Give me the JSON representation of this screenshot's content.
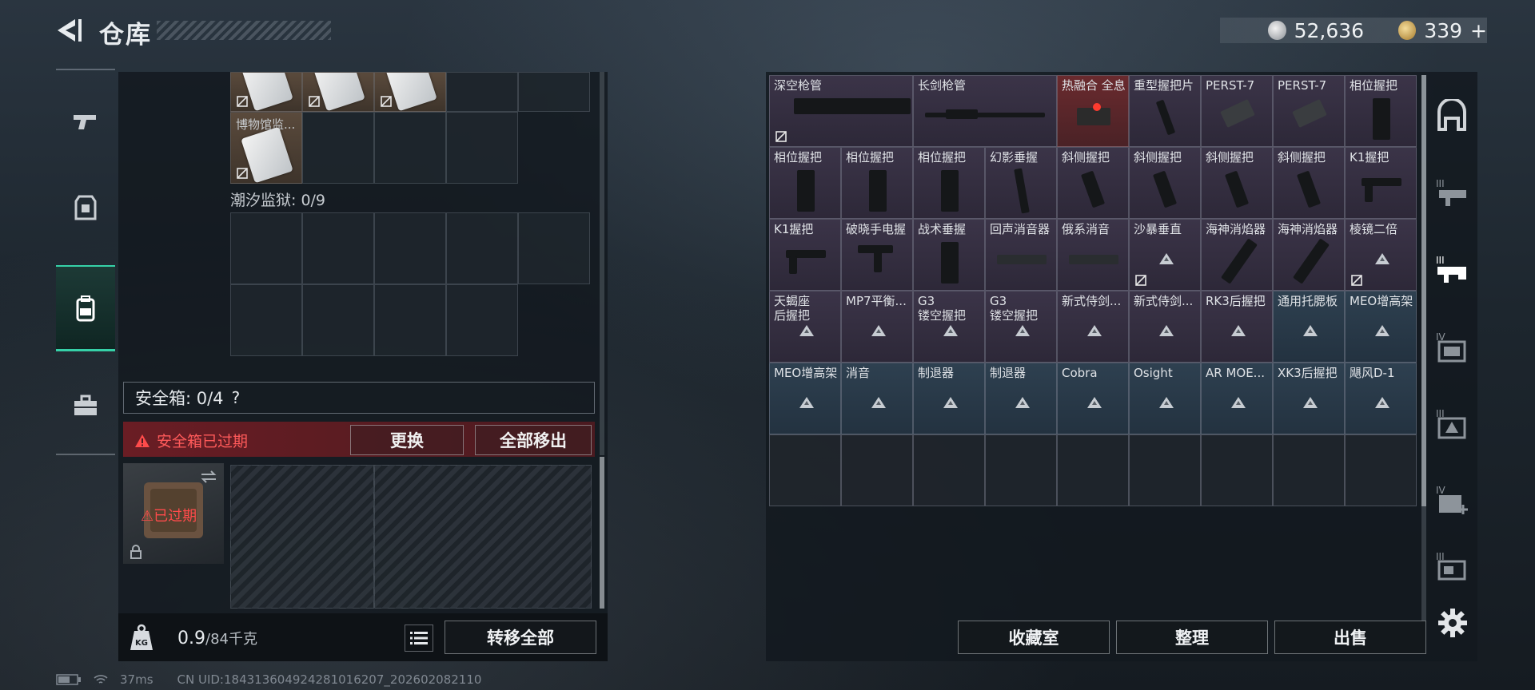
{
  "header": {
    "title": "仓库",
    "silver_amount": "52,636",
    "gold_amount": "339",
    "plus_label": "+"
  },
  "left_tabs": [
    {
      "name": "tab-weapons",
      "icon": "pistol-icon"
    },
    {
      "name": "tab-armor",
      "icon": "armor-icon"
    },
    {
      "name": "tab-backpack",
      "icon": "backpack-icon",
      "active": true
    },
    {
      "name": "tab-toolbox",
      "icon": "toolbox-icon"
    }
  ],
  "container_top": {
    "item_label": "博物馆监...",
    "section_title": "潮汐监狱: 0/9"
  },
  "safe": {
    "title": "安全箱: 0/4",
    "help": "?",
    "warning": "安全箱已过期",
    "replace_label": "更换",
    "remove_all_label": "全部移出",
    "expired_label": "已过期"
  },
  "footer": {
    "weight_value": "0.9",
    "weight_total": "/84千克",
    "transfer_all_label": "转移全部"
  },
  "status": {
    "ping": "37ms",
    "uid": "CN UID:184313604924281016207_202602082110"
  },
  "stash": {
    "rows": [
      [
        {
          "label": "深空枪管",
          "color": "purple",
          "art": "barrel-long",
          "locked": true
        },
        {
          "label": "",
          "color": "purple",
          "art": "",
          "span": true
        },
        {
          "label": "长剑枪管",
          "color": "purple",
          "art": "barrel-thin"
        },
        {
          "label": "",
          "color": "purple",
          "art": "",
          "span": true
        },
        {
          "label": "热融合 全息",
          "color": "red",
          "art": "sight"
        },
        {
          "label": "重型握把片",
          "color": "purple",
          "art": "plate"
        },
        {
          "label": "PERST-7",
          "color": "purple",
          "art": "laser"
        },
        {
          "label": "PERST-7",
          "color": "purple",
          "art": "laser"
        },
        {
          "label": "相位握把",
          "color": "purple",
          "art": "grip"
        }
      ],
      [
        {
          "label": "相位握把",
          "color": "purple",
          "art": "grip"
        },
        {
          "label": "相位握把",
          "color": "purple",
          "art": "grip"
        },
        {
          "label": "相位握把",
          "color": "purple",
          "art": "grip"
        },
        {
          "label": "幻影垂握",
          "color": "purple",
          "art": "vgrip"
        },
        {
          "label": "斜侧握把",
          "color": "purple",
          "art": "angled"
        },
        {
          "label": "斜侧握把",
          "color": "purple",
          "art": "angled"
        },
        {
          "label": "斜侧握把",
          "color": "purple",
          "art": "angled"
        },
        {
          "label": "斜侧握把",
          "color": "purple",
          "art": "angled"
        },
        {
          "label": "K1握把",
          "color": "purple",
          "art": "k1"
        }
      ],
      [
        {
          "label": "K1握把",
          "color": "purple",
          "art": "k1"
        },
        {
          "label": "破晓手电握",
          "color": "purple",
          "art": "flash"
        },
        {
          "label": "战术垂握",
          "color": "purple",
          "art": "grip"
        },
        {
          "label": "回声消音器",
          "color": "purple",
          "art": "suppressor"
        },
        {
          "label": "俄系消音",
          "color": "purple",
          "art": "suppressor"
        },
        {
          "label": "沙暴垂直",
          "color": "purple",
          "art": "tri",
          "locked": true
        },
        {
          "label": "海神消焰器",
          "color": "purple",
          "art": "flashhider"
        },
        {
          "label": "海神消焰器",
          "color": "purple",
          "art": "flashhider"
        },
        {
          "label": "棱镜二倍",
          "color": "purple",
          "art": "tri",
          "locked": true
        }
      ],
      [
        {
          "label": "天蝎座\n后握把",
          "color": "purple",
          "art": "tri"
        },
        {
          "label": "MP7平衡...",
          "color": "purple",
          "art": "tri"
        },
        {
          "label": "G3\n镂空握把",
          "color": "purple",
          "art": "tri"
        },
        {
          "label": "G3\n镂空握把",
          "color": "purple",
          "art": "tri"
        },
        {
          "label": "新式侍剑...",
          "color": "purple",
          "art": "tri"
        },
        {
          "label": "新式侍剑...",
          "color": "purple",
          "art": "tri"
        },
        {
          "label": "RK3后握把",
          "color": "purple",
          "art": "tri"
        },
        {
          "label": "通用托腮板",
          "color": "blue",
          "art": "tri"
        },
        {
          "label": "MEO增高架",
          "color": "blue",
          "art": "tri"
        }
      ],
      [
        {
          "label": "MEO增高架",
          "color": "blue",
          "art": "tri"
        },
        {
          "label": "消音",
          "color": "blue",
          "art": "tri"
        },
        {
          "label": "制退器",
          "color": "blue",
          "art": "tri"
        },
        {
          "label": "制退器",
          "color": "blue",
          "art": "tri"
        },
        {
          "label": "Cobra",
          "color": "blue",
          "art": "tri"
        },
        {
          "label": "Osight",
          "color": "blue",
          "art": "tri"
        },
        {
          "label": "AR MOE...",
          "color": "blue",
          "art": "tri"
        },
        {
          "label": "XK3后握把",
          "color": "blue",
          "art": "tri"
        },
        {
          "label": "飓风D-1",
          "color": "blue",
          "art": "tri"
        }
      ]
    ]
  },
  "actions": {
    "collection_label": "收藏室",
    "sort_label": "整理",
    "sell_label": "出售"
  },
  "right_tabs": [
    {
      "name": "tab-all",
      "icon": "stash-icon"
    },
    {
      "name": "tab-level-3-a",
      "icon": "level-3-icon"
    },
    {
      "name": "tab-level-3-b",
      "icon": "level-3-active-icon",
      "active": true
    },
    {
      "name": "tab-level-4-a",
      "icon": "level-4-icon"
    },
    {
      "name": "tab-level-3-c",
      "icon": "level-3-alt-icon"
    },
    {
      "name": "tab-level-4-b",
      "icon": "level-4-plus-icon"
    },
    {
      "name": "tab-level-3-d",
      "icon": "level-3-c-icon"
    }
  ]
}
